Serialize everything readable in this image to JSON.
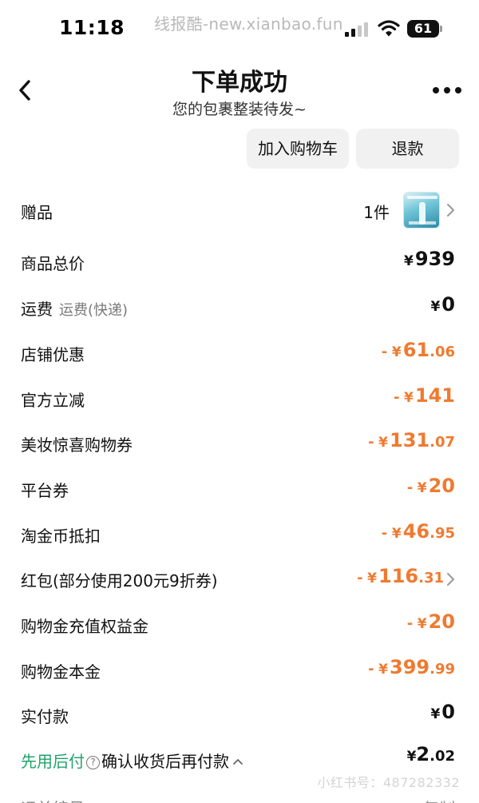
{
  "status_bar": {
    "time": "11:18",
    "watermark": "线报酷-new.xianbao.fun",
    "battery": "61"
  },
  "header": {
    "title": "下单成功",
    "subtitle": "您的包裹整装待发~"
  },
  "actions": {
    "add_to_cart": "加入购物车",
    "refund": "退款"
  },
  "gift": {
    "label": "赠品",
    "count": "1件"
  },
  "rows": {
    "total": {
      "label": "商品总价",
      "sign": "",
      "yen": "¥",
      "int": "939",
      "dec": ""
    },
    "shipping": {
      "label": "运费",
      "sub": "运费(快递)",
      "sign": "",
      "yen": "¥",
      "int": "0",
      "dec": ""
    },
    "shop_discount": {
      "label": "店铺优惠",
      "sign": "-",
      "yen": "¥",
      "int": "61",
      "dec": ".06"
    },
    "official_cut": {
      "label": "官方立减",
      "sign": "-",
      "yen": "¥",
      "int": "141",
      "dec": ""
    },
    "beauty_coupon": {
      "label": "美妆惊喜购物券",
      "sign": "-",
      "yen": "¥",
      "int": "131",
      "dec": ".07"
    },
    "platform_coupon": {
      "label": "平台券",
      "sign": "-",
      "yen": "¥",
      "int": "20",
      "dec": ""
    },
    "taojinbi": {
      "label": "淘金币抵扣",
      "sign": "-",
      "yen": "¥",
      "int": "46",
      "dec": ".95"
    },
    "red_packet": {
      "label": "红包(部分使用200元9折券)",
      "sign": "-",
      "yen": "¥",
      "int": "116",
      "dec": ".31"
    },
    "shopping_gold_bonus": {
      "label": "购物金充值权益金",
      "sign": "-",
      "yen": "¥",
      "int": "20",
      "dec": ""
    },
    "shopping_gold_principal": {
      "label": "购物金本金",
      "sign": "-",
      "yen": "¥",
      "int": "399",
      "dec": ".99"
    },
    "actual_paid": {
      "label": "实付款",
      "sign": "",
      "yen": "¥",
      "int": "0",
      "dec": ""
    }
  },
  "pay_later": {
    "green": "先用后付",
    "text": "确认收货后再付款",
    "amount_yen": "¥",
    "amount_int": "2",
    "amount_dec": ".02"
  },
  "watermark_bottom": "小红书号：487282332",
  "bottom_partial": {
    "left": "运单编号",
    "right": "复制"
  },
  "colors": {
    "accent_orange": "#ef7a30",
    "accent_green": "#21a36a"
  }
}
